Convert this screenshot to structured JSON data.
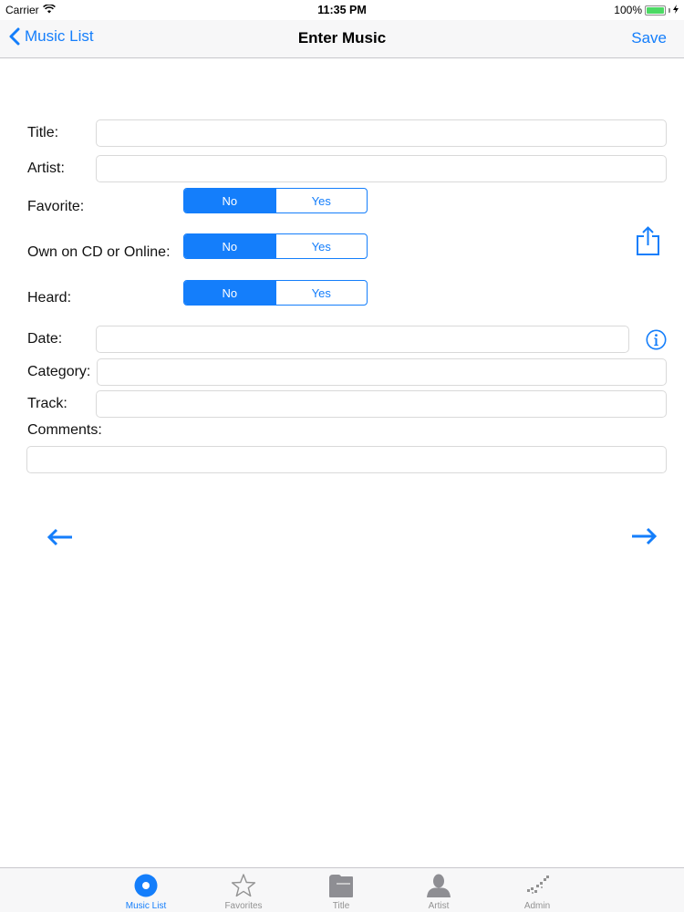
{
  "status_bar": {
    "carrier": "Carrier",
    "time": "11:35 PM",
    "battery": "100%"
  },
  "nav": {
    "back_label": "Music List",
    "title": "Enter Music",
    "save_label": "Save"
  },
  "form": {
    "title_label": "Title:",
    "title_value": "",
    "artist_label": "Artist:",
    "artist_value": "",
    "favorite_label": "Favorite:",
    "own_label": "Own on CD or Online:",
    "heard_label": "Heard:",
    "segment_no": "No",
    "segment_yes": "Yes",
    "favorite_selected": "No",
    "own_selected": "No",
    "heard_selected": "No",
    "date_label": "Date:",
    "date_value": "",
    "category_label": "Category:",
    "category_value": "",
    "track_label": "Track:",
    "track_value": "",
    "comments_label": "Comments:",
    "comments_value": ""
  },
  "icons": {
    "share": "share-icon",
    "info": "info-icon",
    "prev": "arrow-left-icon",
    "next": "arrow-right-icon"
  },
  "tabs": [
    {
      "label": "Music List",
      "icon": "disc-icon",
      "active": true
    },
    {
      "label": "Favorites",
      "icon": "star-icon",
      "active": false
    },
    {
      "label": "Title",
      "icon": "folder-icon",
      "active": false
    },
    {
      "label": "Artist",
      "icon": "person-icon",
      "active": false
    },
    {
      "label": "Admin",
      "icon": "admin-icon",
      "active": false
    }
  ],
  "colors": {
    "accent": "#147efb",
    "tab_inactive": "#929292",
    "bar_background": "#f7f7f8"
  }
}
